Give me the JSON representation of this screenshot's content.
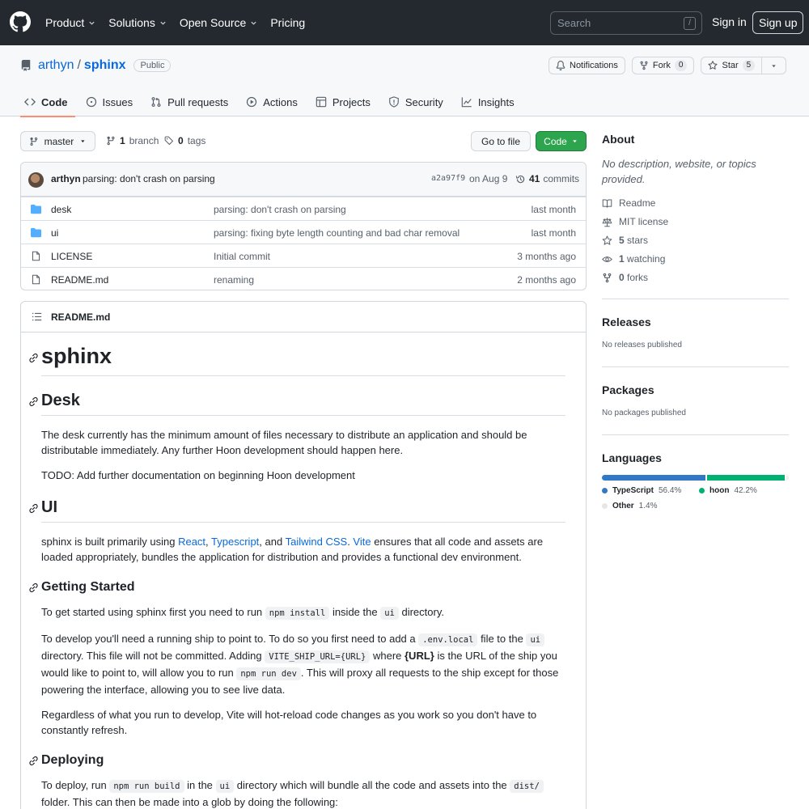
{
  "header": {
    "nav": [
      {
        "label": "Product",
        "dropdown": true
      },
      {
        "label": "Solutions",
        "dropdown": true
      },
      {
        "label": "Open Source",
        "dropdown": true
      },
      {
        "label": "Pricing",
        "dropdown": false
      }
    ],
    "search_placeholder": "Search",
    "search_shortcut": "/",
    "signin": "Sign in",
    "signup": "Sign up"
  },
  "repo": {
    "owner": "arthyn",
    "separator": "/",
    "name": "sphinx",
    "visibility": "Public",
    "notifications_label": "Notifications",
    "fork_label": "Fork",
    "fork_count": "0",
    "star_label": "Star",
    "star_count": "5"
  },
  "tabs": [
    {
      "label": "Code",
      "icon": "code-icon",
      "active": true
    },
    {
      "label": "Issues",
      "icon": "issue-icon",
      "active": false
    },
    {
      "label": "Pull requests",
      "icon": "pull-request-icon",
      "active": false
    },
    {
      "label": "Actions",
      "icon": "play-icon",
      "active": false
    },
    {
      "label": "Projects",
      "icon": "table-icon",
      "active": false
    },
    {
      "label": "Security",
      "icon": "shield-icon",
      "active": false
    },
    {
      "label": "Insights",
      "icon": "graph-icon",
      "active": false
    }
  ],
  "toolbar": {
    "branch": "master",
    "branches_count": "1",
    "branches_label": "branch",
    "tags_count": "0",
    "tags_label": "tags",
    "goto_file": "Go to file",
    "code_button": "Code"
  },
  "commit": {
    "author": "arthyn",
    "message": "parsing: don't crash on parsing",
    "sha": "a2a97f9",
    "date": "on Aug 9",
    "count": "41",
    "count_label": "commits"
  },
  "files": [
    {
      "name": "desk",
      "type": "dir",
      "message": "parsing: don't crash on parsing",
      "age": "last month"
    },
    {
      "name": "ui",
      "type": "dir",
      "message": "parsing: fixing byte length counting and bad char removal",
      "age": "last month"
    },
    {
      "name": "LICENSE",
      "type": "file",
      "message": "Initial commit",
      "age": "3 months ago"
    },
    {
      "name": "README.md",
      "type": "file",
      "message": "renaming",
      "age": "2 months ago"
    }
  ],
  "readme": {
    "filename": "README.md",
    "h1": "sphinx",
    "desk_title": "Desk",
    "desk_p1": "The desk currently has the minimum amount of files necessary to distribute an application and should be distributable immediately. Any further Hoon development should happen here.",
    "desk_p2": "TODO: Add further documentation on beginning Hoon development",
    "ui_title": "UI",
    "ui_p1_a": "sphinx is built primarily using ",
    "ui_link_react": "React",
    "ui_sep1": ", ",
    "ui_link_ts": "Typescript",
    "ui_sep2": ", and ",
    "ui_link_tailwind": "Tailwind CSS",
    "ui_sep3": ". ",
    "ui_link_vite": "Vite",
    "ui_p1_b": " ensures that all code and assets are loaded appropriately, bundles the application for distribution and provides a functional dev environment.",
    "gs_title": "Getting Started",
    "gs_p1_a": "To get started using sphinx first you need to run ",
    "gs_p1_code1": "npm install",
    "gs_p1_b": " inside the ",
    "gs_p1_code2": "ui",
    "gs_p1_c": " directory.",
    "gs_p2_a": "To develop you'll need a running ship to point to. To do so you first need to add a ",
    "gs_p2_code1": ".env.local",
    "gs_p2_b": " file to the ",
    "gs_p2_code2": "ui",
    "gs_p2_c": " directory. This file will not be committed. Adding ",
    "gs_p2_code3": "VITE_SHIP_URL={URL}",
    "gs_p2_d": " where ",
    "gs_p2_strong": "{URL}",
    "gs_p2_e": " is the URL of the ship you would like to point to, will allow you to run ",
    "gs_p2_code4": "npm run dev",
    "gs_p2_f": ". This will proxy all requests to the ship except for those powering the interface, allowing you to see live data.",
    "gs_p3": "Regardless of what you run to develop, Vite will hot-reload code changes as you work so you don't have to constantly refresh.",
    "dep_title": "Deploying",
    "dep_p1_a": "To deploy, run ",
    "dep_p1_code1": "npm run build",
    "dep_p1_b": " in the ",
    "dep_p1_code2": "ui",
    "dep_p1_c": " directory which will bundle all the code and assets into the ",
    "dep_p1_code3": "dist/",
    "dep_p1_d": " folder. This can then be made into a glob by doing the following:"
  },
  "sidebar": {
    "about_title": "About",
    "about_desc": "No description, website, or topics provided.",
    "readme_label": "Readme",
    "license_label": "MIT license",
    "stars_count": "5",
    "stars_label": "stars",
    "watching_count": "1",
    "watching_label": "watching",
    "forks_count": "0",
    "forks_label": "forks",
    "releases_title": "Releases",
    "releases_empty": "No releases published",
    "packages_title": "Packages",
    "packages_empty": "No packages published",
    "languages_title": "Languages",
    "languages": [
      {
        "name": "TypeScript",
        "percent": "56.4%",
        "value": 56.4,
        "color": "#3178c6"
      },
      {
        "name": "hoon",
        "percent": "42.2%",
        "value": 42.2,
        "color": "#00b171"
      },
      {
        "name": "Other",
        "percent": "1.4%",
        "value": 1.4,
        "color": "#ededed"
      }
    ]
  },
  "colors": {
    "header_bg": "#24292f",
    "link": "#0969da",
    "primary_button": "#2da44e",
    "active_tab_underline": "#fd8c73"
  }
}
